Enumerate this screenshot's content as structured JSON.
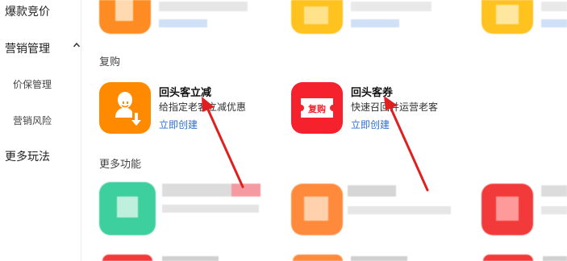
{
  "sidebar": {
    "items": [
      {
        "label": "爆款竞价"
      },
      {
        "label": "营销管理"
      },
      {
        "label": "价保管理"
      },
      {
        "label": "营销风险"
      },
      {
        "label": "更多玩法"
      }
    ],
    "expand_icon": "chevron-up-icon"
  },
  "sections": {
    "repurchase": {
      "title": "复购"
    },
    "more": {
      "title": "更多功能"
    }
  },
  "cards": [
    {
      "title": "回头客立减",
      "desc": "给指定老客立减优惠",
      "link": "立即创建",
      "icon": "user-download-icon",
      "color": "#ff8a00"
    },
    {
      "title": "回头客券",
      "desc": "快速召回并运营老客",
      "link": "立即创建",
      "icon": "coupon-icon",
      "icon_text": "复购",
      "color": "#f5222d"
    }
  ],
  "annotation_color": "#e02020"
}
